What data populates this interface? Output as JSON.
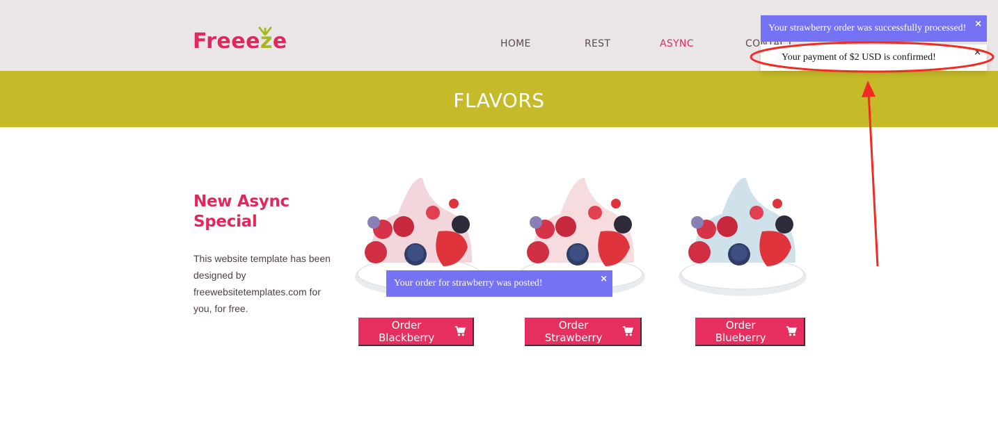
{
  "brand": {
    "logo_prefix": "Free",
    "logo_accent": "e",
    "logo_z": "z",
    "logo_suffix": "e",
    "primary_color": "#e0285d",
    "accent_color": "#a8b728"
  },
  "nav": {
    "items": [
      {
        "label": "HOME",
        "active": false
      },
      {
        "label": "REST",
        "active": false
      },
      {
        "label": "ASYNC",
        "active": true
      },
      {
        "label": "CONTACT",
        "active": false
      }
    ]
  },
  "banner": {
    "title": "FLAVORS",
    "color": "#c4ba2a"
  },
  "promo": {
    "title": "New Async Special",
    "text": "This website template has been designed by freewebsitetemplates.com for you, for free."
  },
  "flavors": [
    {
      "button_label": "Order Blackberry",
      "cream_color": "#f3d5dc",
      "icon": "cart-icon"
    },
    {
      "button_label": "Order Strawberry",
      "cream_color": "#f6dcde",
      "icon": "cart-icon"
    },
    {
      "button_label": "Order Blueberry",
      "cream_color": "#cfe2ec",
      "icon": "cart-icon"
    }
  ],
  "toasts": {
    "processed": {
      "text": "Your strawberry order was successfully processed!",
      "close": "×"
    },
    "payment": {
      "text": "Your payment of $2 USD is confirmed!",
      "close": "×"
    },
    "posted": {
      "text": "Your order for strawberry was posted!",
      "close": "×"
    }
  },
  "annotation": {
    "color": "#f22b22"
  }
}
